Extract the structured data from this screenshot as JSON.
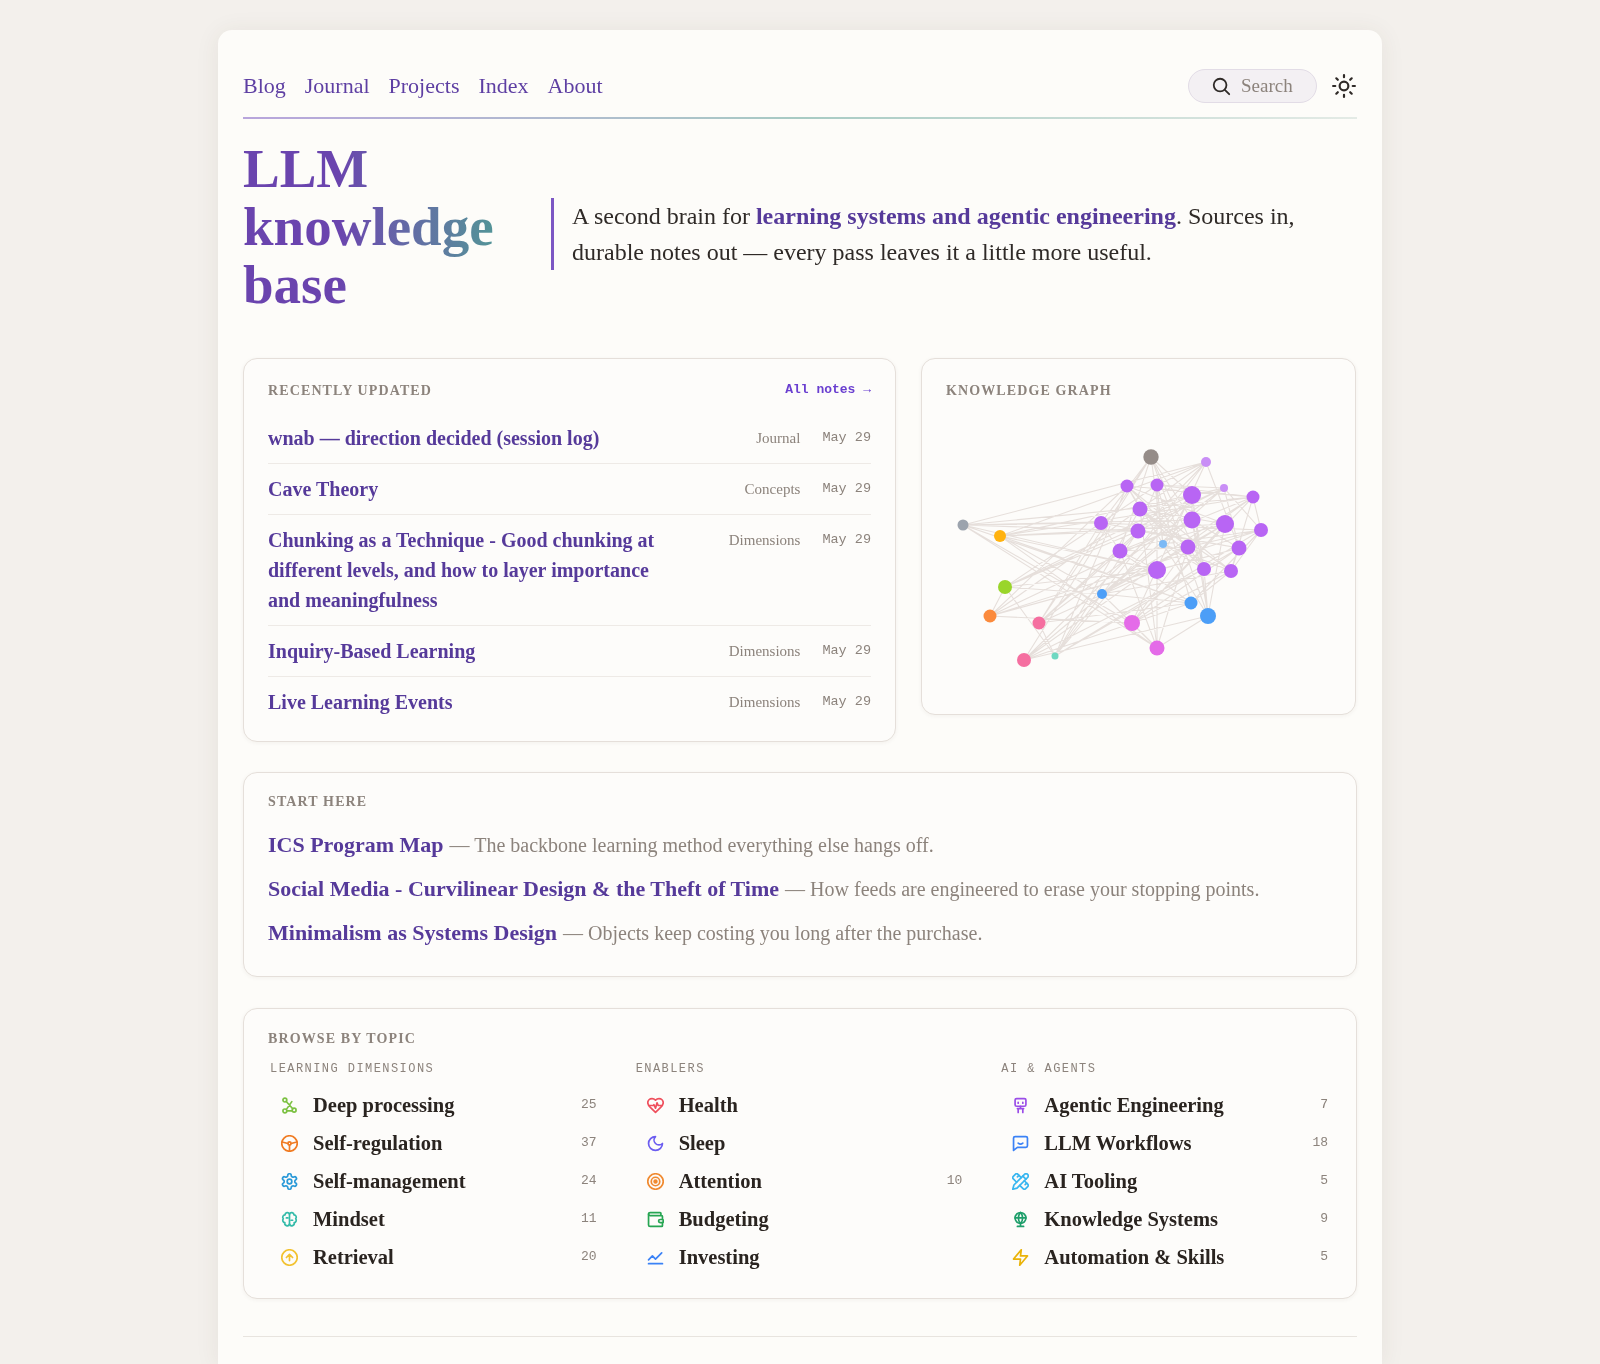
{
  "nav": {
    "links": [
      {
        "label": "Blog"
      },
      {
        "label": "Journal"
      },
      {
        "label": "Projects"
      },
      {
        "label": "Index"
      },
      {
        "label": "About"
      }
    ],
    "search": {
      "label": "Search"
    }
  },
  "hero": {
    "title": "LLM knowledge base",
    "tagline": "A second brain for **learning systems and agentic engineering**. Sources in, durable notes out — every pass leaves it a little more useful."
  },
  "recent": {
    "title": "RECENTLY UPDATED",
    "all_link": "All notes →",
    "rows": [
      {
        "title": "wnab — direction decided (session log)",
        "category": "Journal",
        "date": "May 29"
      },
      {
        "title": "Cave Theory",
        "category": "Concepts",
        "date": "May 29"
      },
      {
        "title": "Chunking as a Technique - Good chunking at different levels, and how to layer importance and meaningfulness",
        "category": "Dimensions",
        "date": "May 29"
      },
      {
        "title": "Inquiry-Based Learning",
        "category": "Dimensions",
        "date": "May 29"
      },
      {
        "title": "Live Learning Events",
        "category": "Dimensions",
        "date": "May 29"
      }
    ]
  },
  "graph": {
    "title": "KNOWLEDGE GRAPH"
  },
  "start_here": {
    "title": "START HERE",
    "items": [
      {
        "link": "ICS Program Map",
        "description": "— The backbone learning method everything else hangs off."
      },
      {
        "link": "Social Media - Curvilinear Design & the Theft of Time",
        "description": "— How feeds are engineered to erase your stopping points."
      },
      {
        "link": "Minimalism as Systems Design",
        "description": "— Objects keep costing you long after the purchase."
      }
    ]
  },
  "topics": {
    "title": "BROWSE BY TOPIC",
    "groups": [
      {
        "heading": "LEARNING DIMENSIONS",
        "items": [
          {
            "label": "Deep processing",
            "count": "25",
            "color": "#7cc142"
          },
          {
            "label": "Self-regulation",
            "count": "37",
            "color": "#f07b22"
          },
          {
            "label": "Self-management",
            "count": "24",
            "color": "#2b9ad8"
          },
          {
            "label": "Mindset",
            "count": "11",
            "color": "#34bba9"
          },
          {
            "label": "Retrieval",
            "count": "20",
            "color": "#f2c230"
          }
        ]
      },
      {
        "heading": "ENABLERS",
        "items": [
          {
            "label": "Health",
            "color": "#ef4f5c"
          },
          {
            "label": "Sleep",
            "color": "#6b5cf0"
          },
          {
            "label": "Attention",
            "count": "10",
            "color": "#f08a30"
          },
          {
            "label": "Budgeting",
            "color": "#26a552"
          },
          {
            "label": "Investing",
            "color": "#3b82f6"
          }
        ]
      },
      {
        "heading": "AI & AGENTS",
        "items": [
          {
            "label": "Agentic Engineering",
            "count": "7",
            "color": "#9b4de8"
          },
          {
            "label": "LLM Workflows",
            "count": "18",
            "color": "#3b82f6"
          },
          {
            "label": "AI Tooling",
            "count": "5",
            "color": "#38b6f0"
          },
          {
            "label": "Knowledge Systems",
            "count": "9",
            "color": "#1e9e6a"
          },
          {
            "label": "Automation & Skills",
            "count": "5",
            "color": "#eab308"
          }
        ]
      }
    ]
  }
}
